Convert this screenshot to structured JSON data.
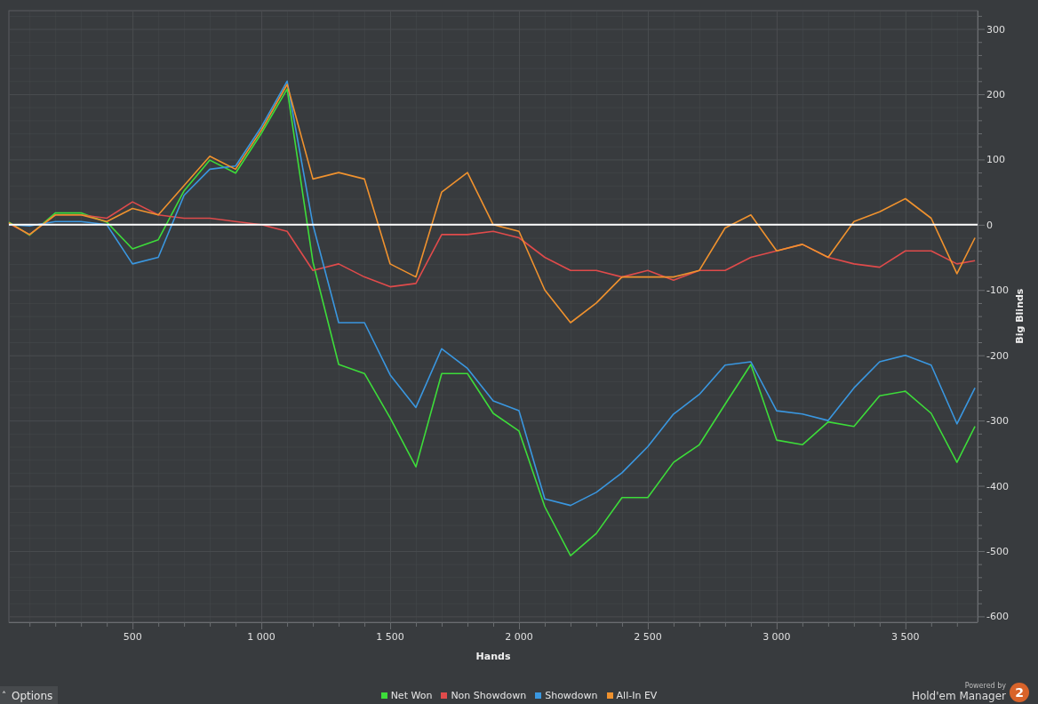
{
  "chart": {
    "chart_data": {
      "type": "line",
      "grid": true,
      "xlabel": "Hands",
      "ylabel": "Big Blinds",
      "x": [
        20,
        100,
        200,
        300,
        400,
        500,
        600,
        700,
        800,
        900,
        1000,
        1100,
        1200,
        1300,
        1400,
        1500,
        1600,
        1700,
        1800,
        1900,
        2000,
        2100,
        2200,
        2300,
        2400,
        2500,
        2600,
        2700,
        2800,
        2900,
        3000,
        3100,
        3200,
        3300,
        3400,
        3500,
        3600,
        3700,
        3770
      ],
      "series": [
        {
          "name": "Net Won",
          "color": "#3ddc3a",
          "values": [
            4,
            -16,
            18,
            18,
            4,
            -37,
            -23,
            52,
            99,
            79,
            140,
            208,
            -57,
            -214,
            -228,
            -296,
            -371,
            -228,
            -228,
            -289,
            -316,
            -432,
            -507,
            -473,
            -418,
            -418,
            -364,
            -337,
            -275,
            -214,
            -330,
            -337,
            -302,
            -309,
            -262,
            -255,
            -289,
            -364,
            -309
          ]
        },
        {
          "name": "Non Showdown",
          "color": "#e04b4b",
          "values": [
            2,
            -15,
            15,
            15,
            10,
            35,
            15,
            10,
            10,
            5,
            0,
            -10,
            -70,
            -60,
            -80,
            -95,
            -90,
            -15,
            -15,
            -10,
            -20,
            -50,
            -70,
            -70,
            -80,
            -70,
            -85,
            -70,
            -70,
            -50,
            -40,
            -30,
            -50,
            -60,
            -65,
            -40,
            -40,
            -60,
            -55
          ]
        },
        {
          "name": "Showdown",
          "color": "#3a97e0",
          "values": [
            0,
            -2,
            5,
            5,
            0,
            -60,
            -50,
            45,
            85,
            90,
            150,
            220,
            0,
            -150,
            -150,
            -230,
            -280,
            -190,
            -220,
            -270,
            -285,
            -420,
            -430,
            -410,
            -380,
            -340,
            -290,
            -260,
            -215,
            -210,
            -285,
            -290,
            -300,
            -250,
            -210,
            -200,
            -215,
            -305,
            -250
          ]
        },
        {
          "name": "All-In EV",
          "color": "#f0922e",
          "values": [
            3,
            -15,
            15,
            15,
            5,
            25,
            15,
            60,
            105,
            85,
            145,
            215,
            70,
            80,
            70,
            -60,
            -80,
            50,
            80,
            0,
            -10,
            -100,
            -150,
            -120,
            -80,
            -80,
            -80,
            -70,
            -5,
            15,
            -40,
            -30,
            -50,
            5,
            20,
            40,
            10,
            -75,
            -20
          ]
        }
      ],
      "xlim": [
        20,
        3780
      ],
      "ylim": [
        -609,
        328
      ],
      "xticks": [
        500,
        {
          "value": 1000,
          "label": "1 000"
        },
        {
          "value": 1500,
          "label": "1 500"
        },
        {
          "value": 2000,
          "label": "2 000"
        },
        {
          "value": 2500,
          "label": "2 500"
        },
        {
          "value": 3000,
          "label": "3 000"
        },
        {
          "value": 3500,
          "label": "3 500"
        }
      ],
      "yticks": [
        -600,
        -500,
        -400,
        -300,
        -200,
        -100,
        0,
        100,
        200,
        300
      ]
    }
  },
  "options_button": {
    "label": "Options",
    "caret": "˄"
  },
  "branding": {
    "powered_by": "Powered by",
    "product": "Hold'em Manager",
    "badge": "2"
  }
}
